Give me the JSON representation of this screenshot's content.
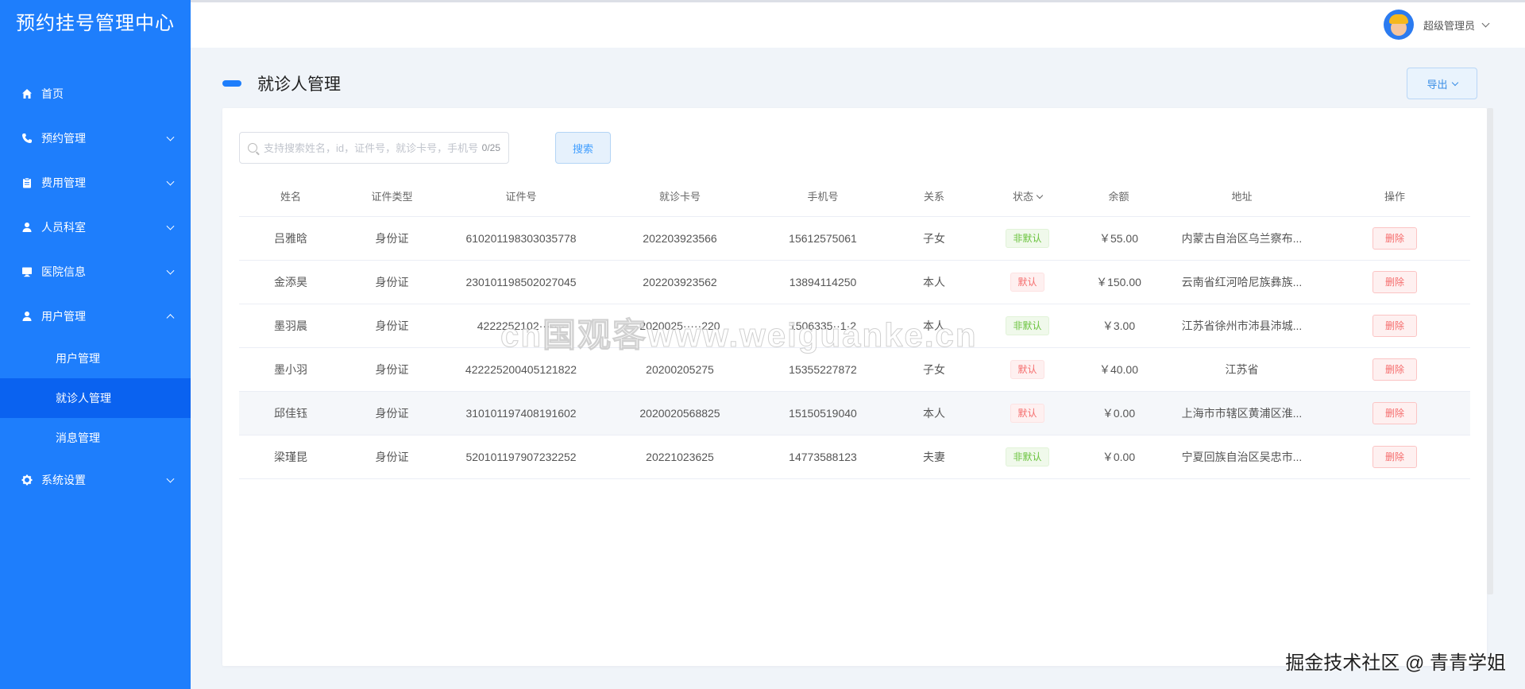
{
  "app": {
    "title": "预约挂号管理中心"
  },
  "sidebar": {
    "items": [
      {
        "label": "首页",
        "icon": "home-icon"
      },
      {
        "label": "预约管理",
        "icon": "phone-icon"
      },
      {
        "label": "费用管理",
        "icon": "clipboard-icon"
      },
      {
        "label": "人员科室",
        "icon": "person-icon"
      },
      {
        "label": "医院信息",
        "icon": "monitor-icon"
      },
      {
        "label": "用户管理",
        "icon": "user-icon"
      },
      {
        "label": "系统设置",
        "icon": "gear-icon"
      }
    ],
    "submenu": [
      "用户管理",
      "就诊人管理",
      "消息管理"
    ],
    "active": "就诊人管理"
  },
  "header": {
    "user_name": "超级管理员"
  },
  "page": {
    "title": "就诊人管理",
    "export_label": "导出"
  },
  "search": {
    "placeholder": "支持搜索姓名，id，证件号，就诊卡号，手机号",
    "count": "0/25",
    "button_label": "搜索"
  },
  "table": {
    "columns": [
      "姓名",
      "证件类型",
      "证件号",
      "就诊卡号",
      "手机号",
      "关系",
      "状态",
      "余额",
      "地址",
      "操作"
    ],
    "delete_label": "删除",
    "rows": [
      {
        "name": "吕雅晗",
        "id_type": "身份证",
        "id_no": "610201198303035778",
        "card_no": "202203923566",
        "phone": "15612575061",
        "relation": "子女",
        "status": "非默认",
        "status_color": "green",
        "balance": "￥55.00",
        "address": "内蒙古自治区乌兰察布..."
      },
      {
        "name": "金添昊",
        "id_type": "身份证",
        "id_no": "230101198502027045",
        "card_no": "202203923562",
        "phone": "13894114250",
        "relation": "本人",
        "status": "默认",
        "status_color": "red",
        "balance": "￥150.00",
        "address": "云南省红河哈尼族彝族..."
      },
      {
        "name": "墨羽晨",
        "id_type": "身份证",
        "id_no": "4222252102·······",
        "card_no": "2020025·····220",
        "phone": "1506335··1·2",
        "relation": "本人",
        "status": "非默认",
        "status_color": "green",
        "balance": "￥3.00",
        "address": "江苏省徐州市沛县沛城..."
      },
      {
        "name": "墨小羽",
        "id_type": "身份证",
        "id_no": "422225200405121822",
        "card_no": "20200205275",
        "phone": "15355227872",
        "relation": "子女",
        "status": "默认",
        "status_color": "red",
        "balance": "￥40.00",
        "address": "江苏省"
      },
      {
        "name": "邱佳钰",
        "id_type": "身份证",
        "id_no": "310101197408191602",
        "card_no": "2020020568825",
        "phone": "15150519040",
        "relation": "本人",
        "status": "默认",
        "status_color": "red",
        "balance": "￥0.00",
        "address": "上海市市辖区黄浦区淮..."
      },
      {
        "name": "梁瑾昆",
        "id_type": "身份证",
        "id_no": "520101197907232252",
        "card_no": "20221023625",
        "phone": "14773588123",
        "relation": "夫妻",
        "status": "非默认",
        "status_color": "green",
        "balance": "￥0.00",
        "address": "宁夏回族自治区吴忠市..."
      }
    ]
  },
  "watermarks": {
    "center": "cn国观客www.weiguanke.cn",
    "corner": "掘金技术社区 @ 青青学姐"
  },
  "colors": {
    "sidebar": "#1e7efc",
    "sidebar_active": "#0a62f0",
    "page_bg": "#f0f4f9"
  }
}
